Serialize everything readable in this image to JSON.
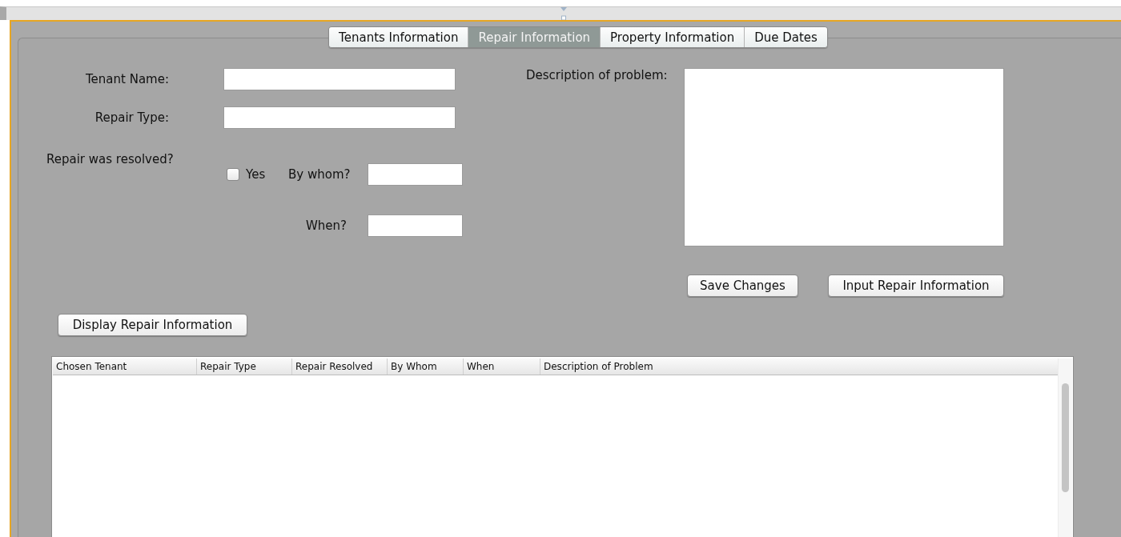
{
  "tabs": [
    {
      "label": "Tenants Information",
      "selected": false
    },
    {
      "label": "Repair Information",
      "selected": true
    },
    {
      "label": "Property Information",
      "selected": false
    },
    {
      "label": "Due Dates",
      "selected": false
    }
  ],
  "form": {
    "tenant_name": {
      "label": "Tenant Name:"
    },
    "repair_type": {
      "label": "Repair Type:"
    },
    "resolved": {
      "label": "Repair was resolved?",
      "checkbox": {
        "label": "Yes",
        "checked": false
      }
    },
    "by_whom": {
      "label": "By whom?"
    },
    "when": {
      "label": "When?"
    },
    "description": {
      "label": "Description of problem:"
    }
  },
  "action_buttons": [
    "Save Changes",
    "Input Repair Information"
  ],
  "display_button": "Display Repair Information",
  "table": {
    "columns": [
      "Chosen Tenant",
      "Repair Type",
      "Repair Resolved",
      "By Whom",
      "When",
      "Description of Problem"
    ]
  }
}
